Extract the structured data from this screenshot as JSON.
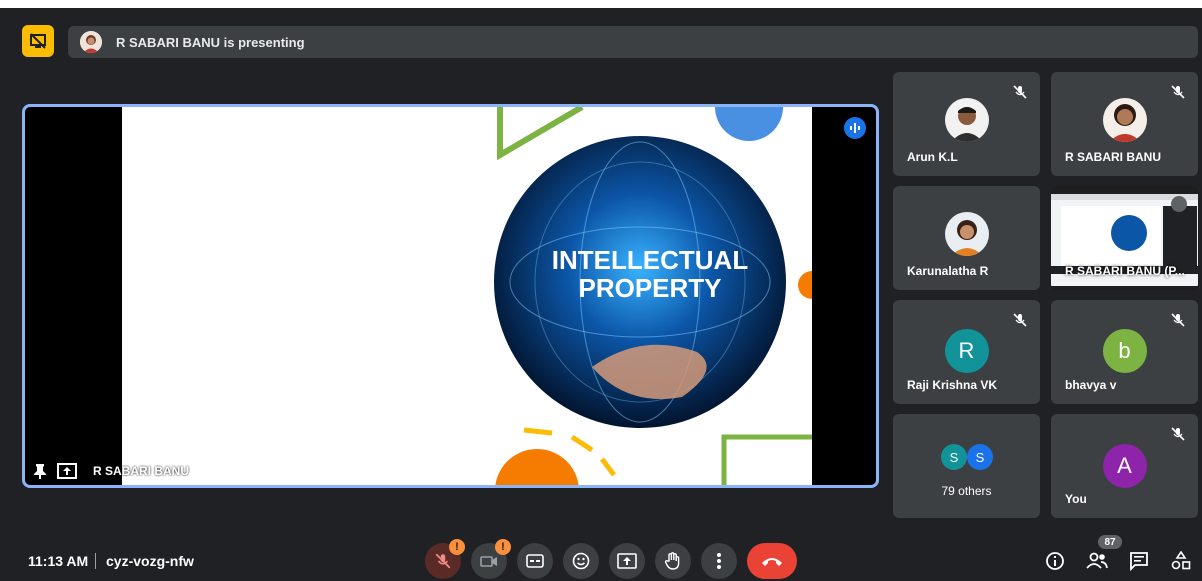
{
  "header": {
    "presenting_text": "R SABARI BANU is presenting"
  },
  "stage": {
    "presenter_name": "R SABARI BANU",
    "slide_title_line1": "INTELLECTUAL",
    "slide_title_line2": "PROPERTY"
  },
  "participants": [
    {
      "name": "Arun K.L",
      "avatar": "photo"
    },
    {
      "name": "R SABARI BANU",
      "avatar": "photo"
    },
    {
      "name": "Karunalatha R",
      "avatar": "photo"
    },
    {
      "name": "R SABARI BANU (P...",
      "avatar": "screen"
    },
    {
      "name": "Raji Krishna VK",
      "initial": "R",
      "color": "#12939a"
    },
    {
      "name": "bhavya v",
      "initial": "b",
      "color": "#7cb342"
    },
    {
      "name": "79 others",
      "initials": [
        "S",
        "S"
      ],
      "colors": [
        "#12939a",
        "#1a73e8"
      ]
    },
    {
      "name": "You",
      "initial": "A",
      "color": "#8e24aa"
    }
  ],
  "footer": {
    "time": "11:13 AM",
    "meeting_code": "cyz-vozg-nfw",
    "warning_mark": "!",
    "participant_count": "87"
  },
  "colors": {
    "accent": "#8ab4f8",
    "end_call": "#ea4335",
    "warning": "#fa903e",
    "presenting": "#fbbc04"
  }
}
